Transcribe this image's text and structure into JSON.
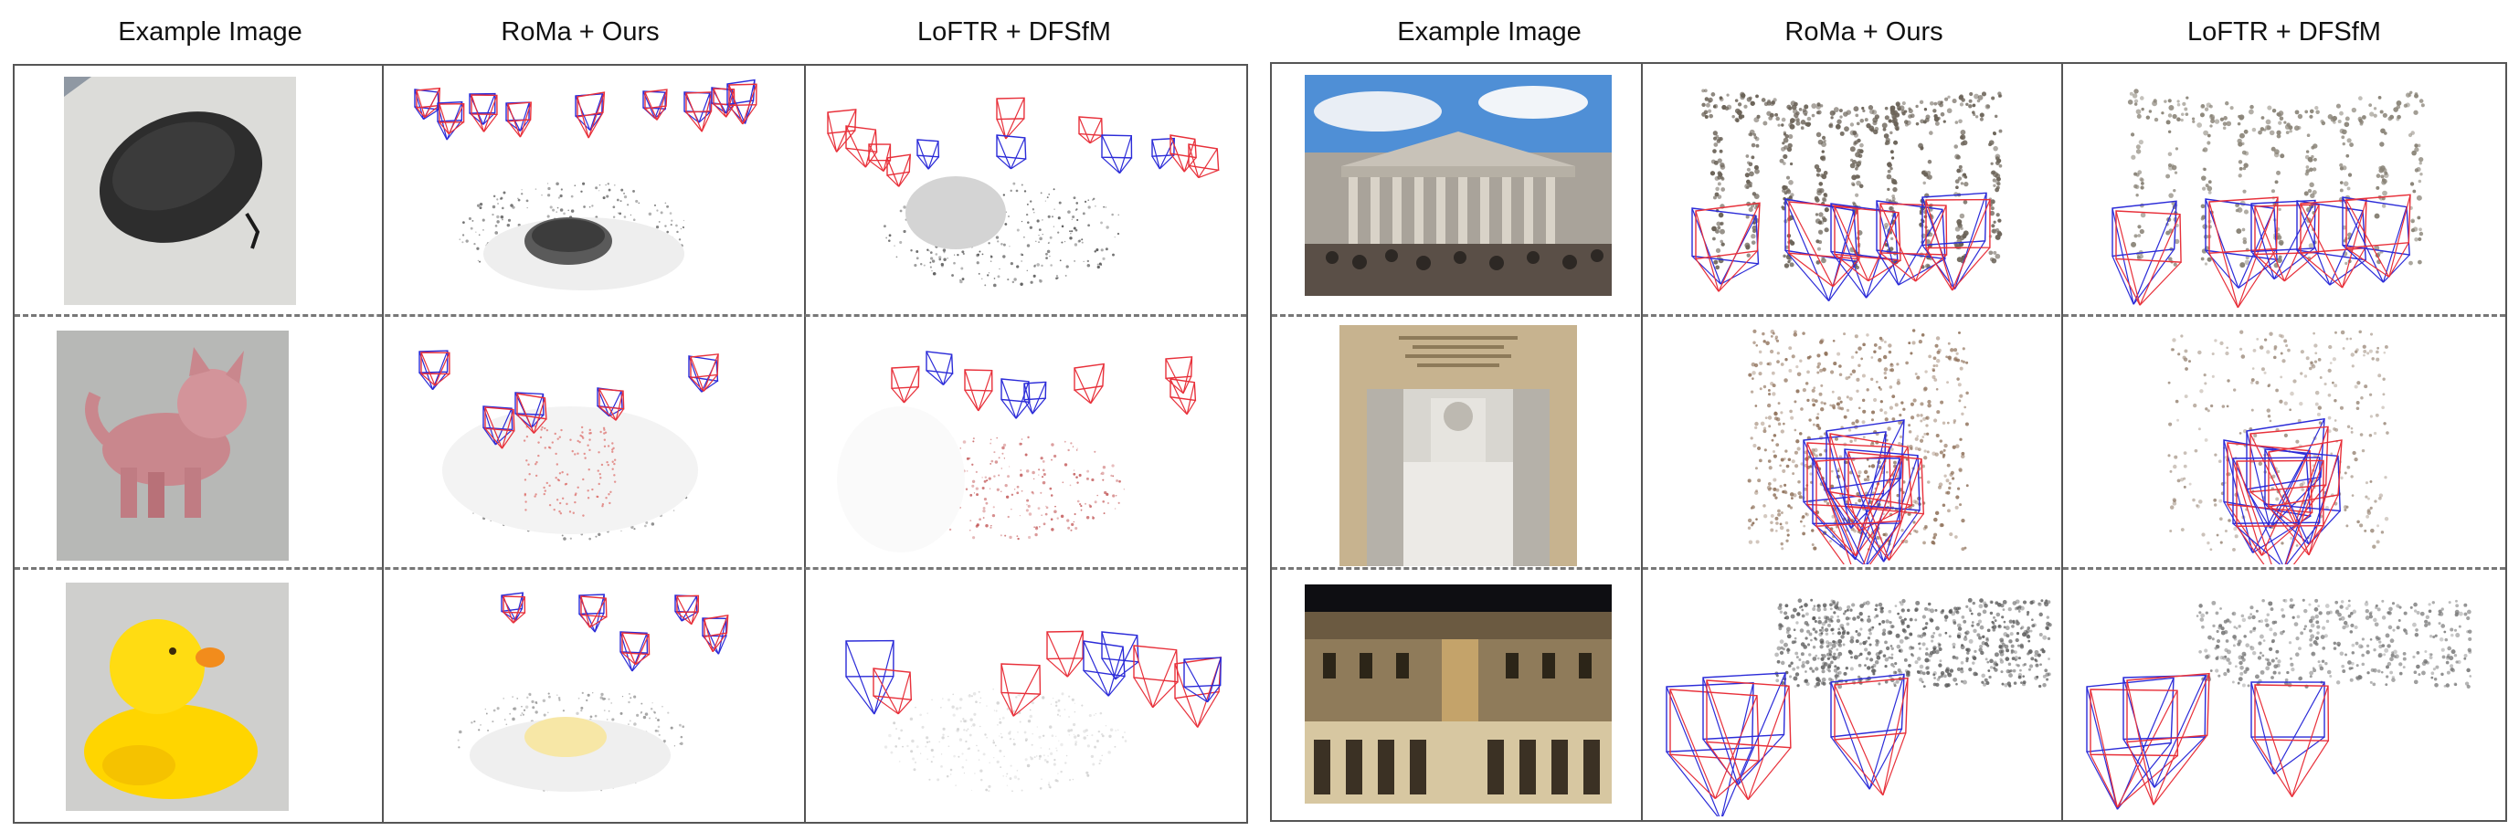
{
  "left_panel": {
    "headers": [
      "Example Image",
      "RoMa + Ours",
      "LoFTR + DFSfM"
    ],
    "rows": [
      {
        "object": "black zipper case"
      },
      {
        "object": "pink toy cat"
      },
      {
        "object": "yellow rubber duck"
      }
    ]
  },
  "right_panel": {
    "headers": [
      "Example Image",
      "RoMa + Ours",
      "LoFTR + DFSfM"
    ],
    "rows": [
      {
        "scene": "British Museum facade"
      },
      {
        "scene": "Lincoln Memorial statue"
      },
      {
        "scene": "Doge's Palace at night"
      }
    ]
  },
  "colors": {
    "camera_blue": "#2b2bd8",
    "camera_red": "#e8303a",
    "camera_purple": "#8a3fb8",
    "border": "#555555",
    "row_divider": "#777777"
  }
}
